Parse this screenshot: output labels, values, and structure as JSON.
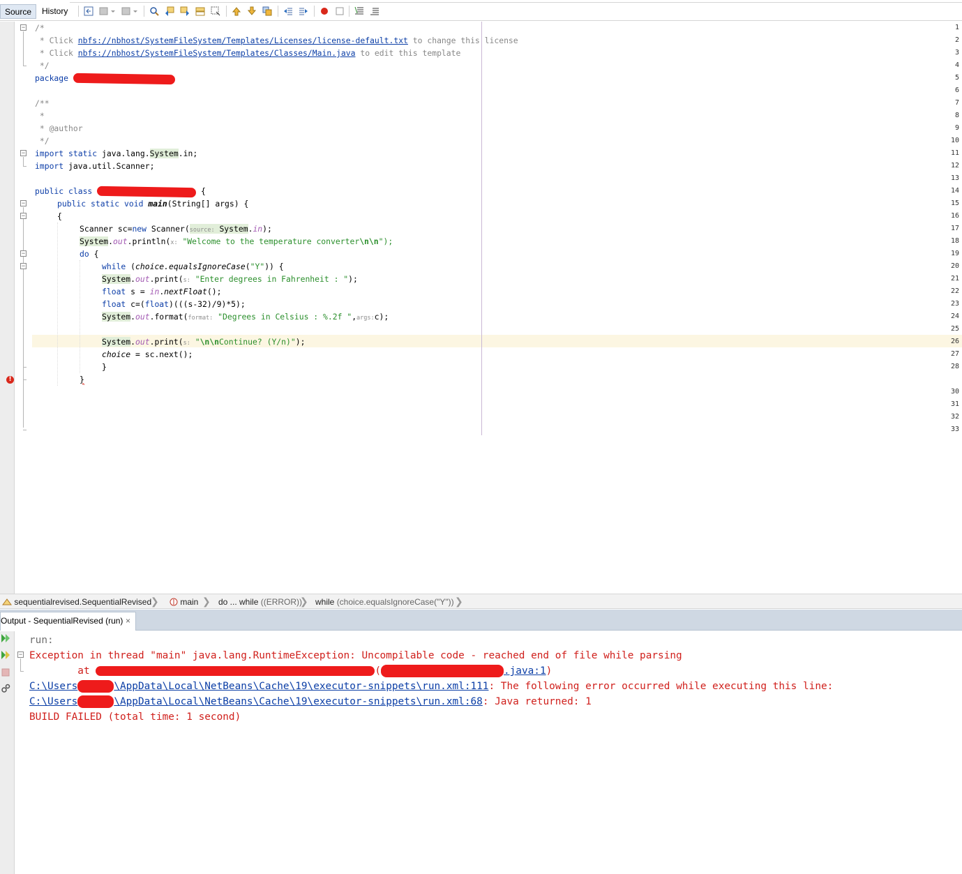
{
  "toolbar": {
    "tabs": [
      {
        "label": "Source",
        "active": true
      },
      {
        "label": "History",
        "active": false
      }
    ],
    "icons": [
      "last-edit-icon",
      "back-icon",
      "forward-icon",
      "find-icon",
      "find-previous-icon",
      "find-next-icon",
      "find-selection-icon",
      "toggle-highlight-icon",
      "previous-bookmark-icon",
      "next-bookmark-icon",
      "toggle-bookmark-icon",
      "shift-left-icon",
      "shift-right-icon",
      "start-macro-icon",
      "stop-macro-icon",
      "comment-icon",
      "uncomment-icon"
    ]
  },
  "editor": {
    "line_numbers": [
      "1",
      "2",
      "3",
      "4",
      "5",
      "6",
      "7",
      "8",
      "9",
      "10",
      "11",
      "12",
      "13",
      "14",
      "15",
      "16",
      "17",
      "18",
      "19",
      "",
      "30",
      "31",
      "32",
      "33"
    ],
    "line_numbers_extra": [
      "20",
      "21",
      "22",
      "23",
      "24",
      "25",
      "26",
      "27",
      "28"
    ],
    "lines": {
      "l1": "/*",
      "l2_prefix": " * Click ",
      "l2_link": "nbfs://nbhost/SystemFileSystem/Templates/Licenses/license-default.txt",
      "l2_suffix": " to change this license",
      "l3_prefix": " * Click ",
      "l3_link": "nbfs://nbhost/SystemFileSystem/Templates/Classes/Main.java",
      "l3_suffix": " to edit this template",
      "l4": " */",
      "l5_kw": "package",
      "l7": "/**",
      "l8": " *",
      "l9": " * @author",
      "l10": " */",
      "l11_kw": "import static",
      "l11_a": " java.lang.",
      "l11_sys": "System",
      "l11_b": ".in;",
      "l12_kw": "import",
      "l12_a": " java.util.Scanner;",
      "l14_kw": "public class",
      "l14_brace": " {",
      "l15_kw": "public static void",
      "l15_name": "main",
      "l15_rest": "(String[] args) {",
      "l16": "{",
      "l17_a": "Scanner sc=",
      "l17_kw": "new",
      "l17_b": " Scanner(",
      "l17_hint": "source:",
      "l17_sys": "System",
      "l17_dot": ".",
      "l17_fld": "in",
      "l17_end": ");",
      "l18_sys": "System",
      "l18_dot": ".",
      "l18_fld": "out",
      "l18_call": ".println(",
      "l18_hint": "x:",
      "l18_str": "\"Welcome to the temperature converter",
      "l18_esc": "\\n\\n",
      "l18_end": "\");",
      "l19_kw": "do",
      "l19_b": " {",
      "l20_kw": "while",
      "l20_a": " (",
      "l20_it": "choice.equalsIgnoreCase",
      "l20_b": "(",
      "l20_str": "\"Y\"",
      "l20_c": ")) {",
      "l21_sys": "System",
      "l21_fld": "out",
      "l21_call": ".print(",
      "l21_hint": "s:",
      "l21_str": "\"Enter degrees in Fahrenheit : \"",
      "l21_end": ");",
      "l22_kw": "float",
      "l22_a": " s = ",
      "l22_in": "in",
      "l22_b": ".",
      "l22_it": "nextFloat",
      "l22_c": "();",
      "l23_kw": "float",
      "l23_a": " c=(",
      "l23_kw2": "float",
      "l23_b": ")(((s-32)/9)*5);",
      "l24_sys": "System",
      "l24_fld": "out",
      "l24_call": ".format(",
      "l24_hint": "format:",
      "l24_str": "\"Degrees in Celsius : %.2f \"",
      "l24_comma": ",",
      "l24_hint2": "args:",
      "l24_end": "c);",
      "l26_sys": "System",
      "l26_fld": "out",
      "l26_call": ".print(",
      "l26_hint": "s:",
      "l26_q": "\"",
      "l26_esc": "\\n\\n",
      "l26_str": "Continue? (Y/n)\"",
      "l26_end": ");",
      "l27_it": "choice",
      "l27_a": " = sc.next();",
      "l28": "}",
      "l29": "}"
    }
  },
  "breadcrumb": {
    "items": [
      {
        "label": "sequentialrevised.SequentialRevised",
        "icon": "class-icon"
      },
      {
        "label": "main",
        "icon": "method-icon"
      },
      {
        "label": "do ... while ",
        "extra": "((ERROR))"
      },
      {
        "label": "while ",
        "extra": "(choice.equalsIgnoreCase(\"Y\"))"
      }
    ]
  },
  "output": {
    "tab_label": "Output - SequentialRevised (run)",
    "close": "×",
    "lines": {
      "run": "run:",
      "exception": "Exception in thread \"main\" java.lang.RuntimeException: Uncompilable code - reached end of file while parsing",
      "at": "        at ",
      "at_paren": "(",
      "at_link": ".java:1",
      "at_close": ")",
      "err1_link_a": "C:\\Users",
      "err1_link_b": "\\AppData\\Local\\NetBeans\\Cache\\19\\executor-snippets\\run.xml:111",
      "err1_msg": ": The following error occurred while executing this line:",
      "err2_link_a": "C:\\Users",
      "err2_link_b": "\\AppData\\Local\\NetBeans\\Cache\\19\\executor-snippets\\run.xml:68",
      "err2_msg": ": Java returned: 1",
      "build": "BUILD FAILED (total time: 1 second)"
    },
    "gutter_icons": [
      "rerun-icon",
      "rerun-with-options-icon",
      "stop-icon",
      "settings-icon"
    ]
  },
  "colors": {
    "keyword": "#0d3ea8",
    "comment": "#878787",
    "string": "#ce7b00",
    "error": "#d0201c",
    "redaction": "#ee1b1b"
  }
}
